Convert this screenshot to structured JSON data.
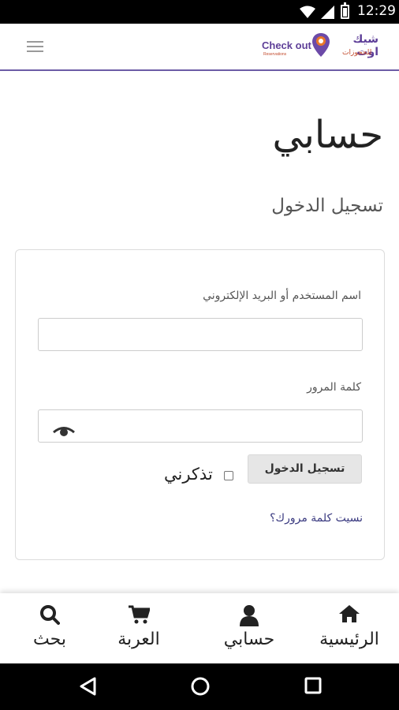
{
  "status_bar": {
    "time": "12:29"
  },
  "header": {
    "logo_text_en": "Check out",
    "logo_subtext_en": "Reservations",
    "logo_text_ar": "شيك اوت",
    "logo_subtext_ar": "للحجوزات",
    "menu_icon": "hamburger-icon",
    "accent_color": "#6c5ba6"
  },
  "page": {
    "title": "حسابي",
    "section_title": "تسجيل الدخول"
  },
  "login_form": {
    "username_label": "اسم المستخدم أو البريد الإلكتروني",
    "username_value": "",
    "password_label": "كلمة المرور",
    "password_value": "",
    "show_password_icon": "eye-icon",
    "submit_label": "تسجيل الدخول",
    "remember_label": "تذكرني",
    "remember_checked": false,
    "forgot_password_link": "نسيت كلمة مرورك؟"
  },
  "bottom_nav": {
    "items": [
      {
        "label": "الرئيسية",
        "icon": "home-icon"
      },
      {
        "label": "حسابي",
        "icon": "user-icon"
      },
      {
        "label": "العربة",
        "icon": "cart-icon"
      },
      {
        "label": "بحث",
        "icon": "search-icon"
      }
    ]
  },
  "system_nav": {
    "buttons": [
      "back-icon",
      "home-circle-icon",
      "recents-icon"
    ]
  }
}
